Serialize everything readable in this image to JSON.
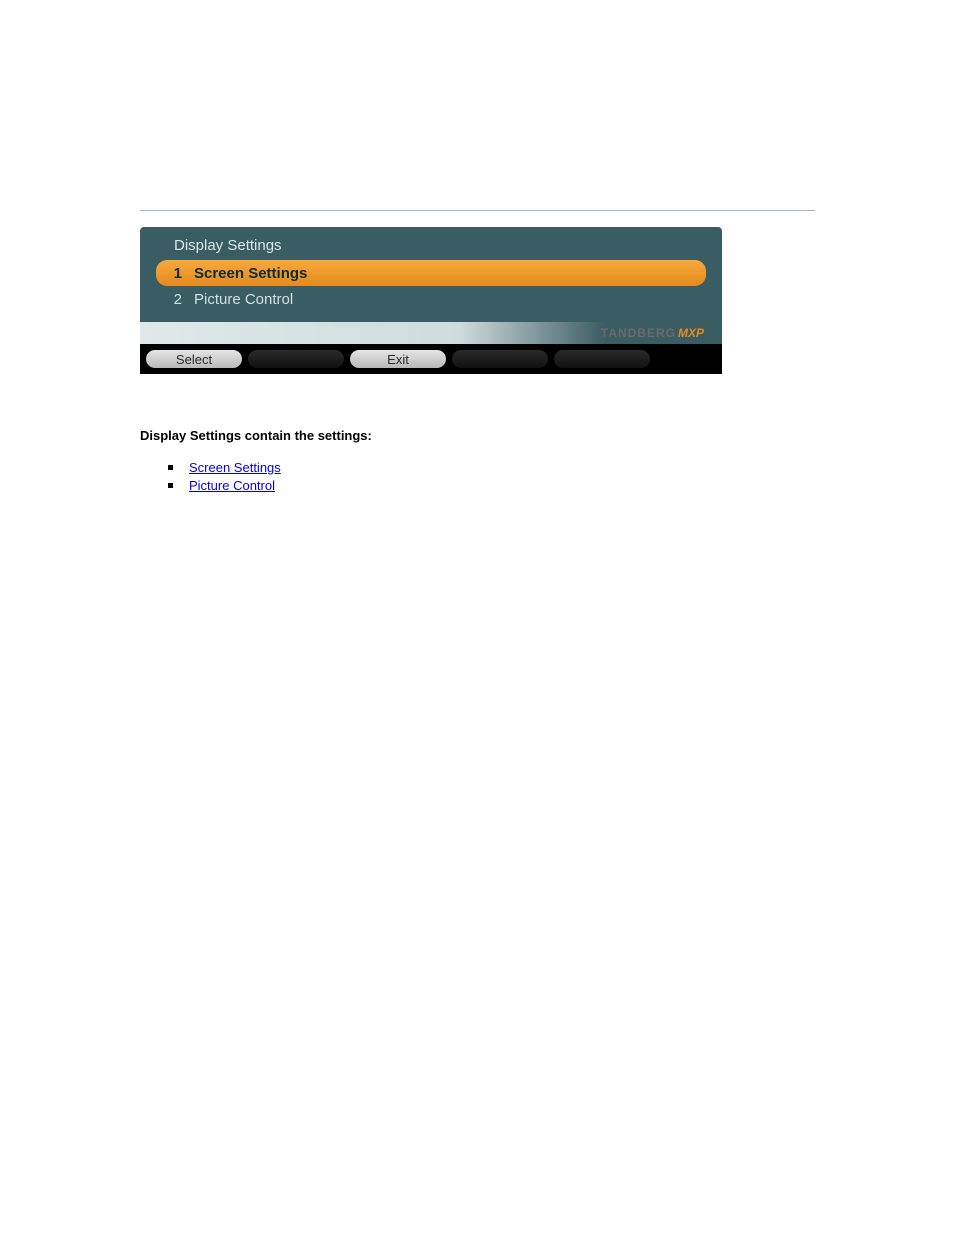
{
  "panel_title": "Display Settings",
  "menu_items": [
    {
      "num": "1",
      "label": "Screen Settings",
      "selected": true
    },
    {
      "num": "2",
      "label": "Picture Control",
      "selected": false
    }
  ],
  "brand": {
    "name": "TANDBERG",
    "suffix": "MXP"
  },
  "buttons": [
    {
      "label": "Select",
      "active": true
    },
    {
      "label": "",
      "active": false
    },
    {
      "label": "Exit",
      "active": true
    },
    {
      "label": "",
      "active": false
    },
    {
      "label": "",
      "active": false
    }
  ],
  "section_caption": "Display Settings contain the settings:",
  "links": [
    {
      "text": "Screen Settings"
    },
    {
      "text": "Picture Control"
    }
  ]
}
